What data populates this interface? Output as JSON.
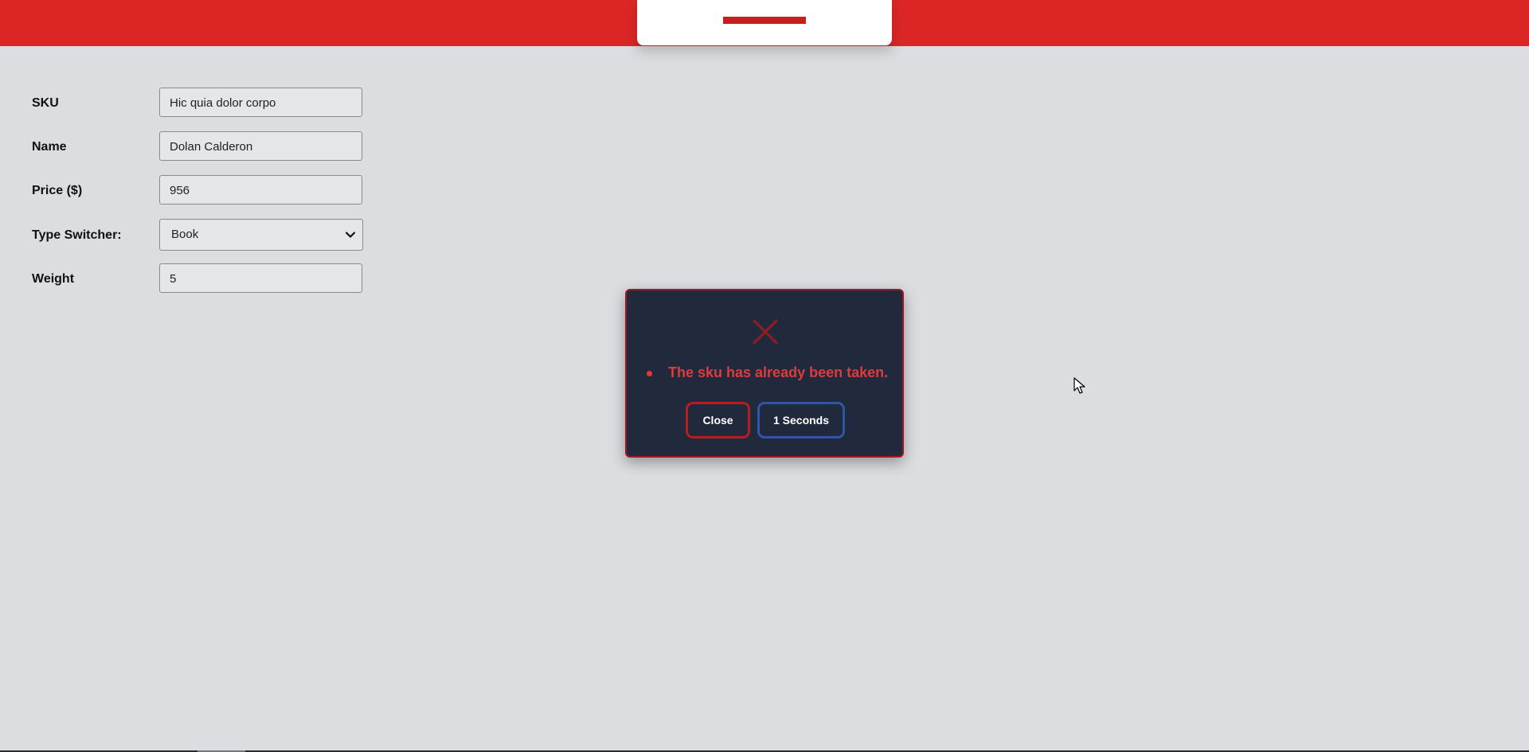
{
  "form": {
    "sku": {
      "label": "SKU",
      "value": "Hic quia dolor corpo"
    },
    "name": {
      "label": "Name",
      "value": "Dolan Calderon"
    },
    "price": {
      "label": "Price ($)",
      "value": "956"
    },
    "type_switcher": {
      "label": "Type Switcher:",
      "selected": "Book"
    },
    "weight": {
      "label": "Weight",
      "value": "5"
    }
  },
  "modal": {
    "icon": "close-x-icon",
    "message": "The sku has already been taken.",
    "close_label": "Close",
    "timer_label": "1 Seconds"
  },
  "colors": {
    "header": "#dc2626",
    "background": "#dcdde1",
    "modal_bg": "#212a3c",
    "error_text": "#e03a3a",
    "close_border": "#b91c1c",
    "timer_border": "#2f56a8"
  }
}
